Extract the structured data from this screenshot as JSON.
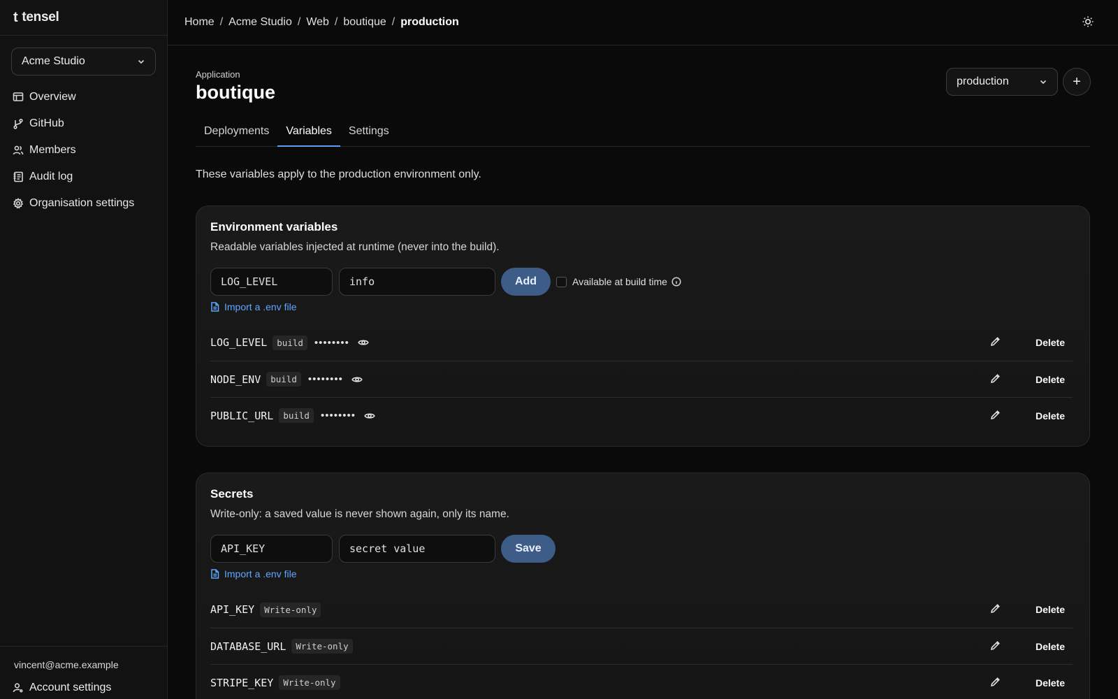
{
  "brand": {
    "name": "tensel",
    "mark": "t"
  },
  "sidebar": {
    "org": "Acme Studio",
    "items": [
      {
        "label": "Overview",
        "icon": "overview-icon"
      },
      {
        "label": "GitHub",
        "icon": "git-branch-icon"
      },
      {
        "label": "Members",
        "icon": "members-icon"
      },
      {
        "label": "Audit log",
        "icon": "audit-log-icon"
      },
      {
        "label": "Organisation settings",
        "icon": "gear-icon"
      }
    ],
    "user_email": "vincent@acme.example",
    "account_settings": "Account settings"
  },
  "breadcrumb": [
    "Home",
    "Acme Studio",
    "Web",
    "boutique",
    "production"
  ],
  "breadcrumb_sep": "/",
  "header": {
    "kind_label": "Application",
    "app_name": "boutique",
    "environment": "production",
    "add_label": "+"
  },
  "tabs": [
    "Deployments",
    "Variables",
    "Settings"
  ],
  "active_tab": "Variables",
  "scope_note": "These variables apply to the production environment only.",
  "env_vars": {
    "title": "Environment variables",
    "description": "Readable variables injected at runtime (never into the build).",
    "name_value": "LOG_LEVEL",
    "value_value": "info",
    "add_label": "Add",
    "build_time_label": "Available at build time",
    "import_label": "Import a .env file",
    "rows": [
      {
        "name": "LOG_LEVEL",
        "tag": "build",
        "masked": "••••••••"
      },
      {
        "name": "NODE_ENV",
        "tag": "build",
        "masked": "••••••••"
      },
      {
        "name": "PUBLIC_URL",
        "tag": "build",
        "masked": "••••••••"
      }
    ],
    "delete_label": "Delete"
  },
  "secrets": {
    "title": "Secrets",
    "description": "Write-only: a saved value is never shown again, only its name.",
    "name_value": "API_KEY",
    "value_value": "secret value",
    "save_label": "Save",
    "import_label": "Import a .env file",
    "rows": [
      {
        "name": "API_KEY",
        "tag": "Write-only"
      },
      {
        "name": "DATABASE_URL",
        "tag": "Write-only"
      },
      {
        "name": "STRIPE_KEY",
        "tag": "Write-only"
      }
    ],
    "delete_label": "Delete"
  },
  "colors": {
    "accent": "#5fa7ff",
    "primary_button": "#3e5c88",
    "background": "#0a0a0a"
  }
}
